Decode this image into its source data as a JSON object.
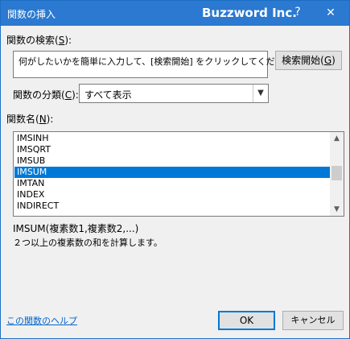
{
  "titlebar": {
    "title": "関数の挿入",
    "brand": "Buzzword Inc.",
    "help": "?",
    "close": "✕"
  },
  "search": {
    "label": "関数の検索(",
    "label_key": "S",
    "label_end": "):",
    "value": "何がしたいかを簡単に入力して、[検索開始] をクリックしてください。",
    "button_label": "検索開始(",
    "button_key": "G",
    "button_end": ")"
  },
  "category": {
    "label": "関数の分類(",
    "label_key": "C",
    "label_end": "):",
    "selected": "すべて表示",
    "arrow_icon": "chevron-down-icon"
  },
  "function_list": {
    "label": "関数名(",
    "label_key": "N",
    "label_end": "):",
    "items": [
      "IMSINH",
      "IMSQRT",
      "IMSUB",
      "IMSUM",
      "IMTAN",
      "INDEX",
      "INDIRECT"
    ],
    "selected_index": 3
  },
  "description": {
    "syntax": "IMSUM(複素数1,複素数2,...)",
    "text": "２つ以上の複素数の和を計算します。"
  },
  "footer": {
    "help_link": "この関数のヘルプ",
    "ok": "OK",
    "cancel": "キャンセル"
  },
  "colors": {
    "titlebar": "#2b79d0",
    "selection": "#0078d7",
    "link": "#0066cc"
  }
}
